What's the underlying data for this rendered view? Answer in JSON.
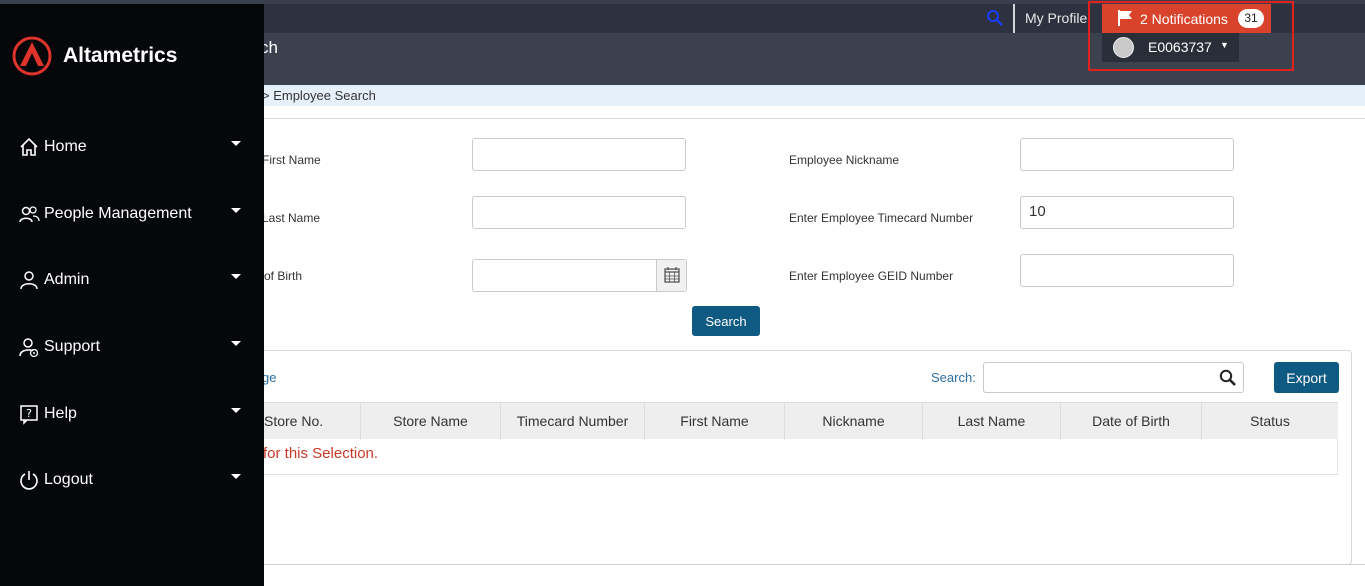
{
  "topbar": {
    "my_profile": "My Profile",
    "notifications_label": "2 Notifications",
    "notifications_badge": "31",
    "user_id": "E0063737"
  },
  "page": {
    "title": "ch",
    "breadcrumb": "> Employee Search"
  },
  "form": {
    "first_name_label": "First Name",
    "last_name_label": "Last Name",
    "dob_label": "of Birth",
    "nickname_label": "Employee Nickname",
    "timecard_label": "Enter Employee Timecard Number",
    "timecard_value": "10",
    "geid_label": "Enter Employee GEID Number",
    "search_button": "Search"
  },
  "results": {
    "page_link": "ge",
    "search_label": "Search:",
    "export_button": "Export",
    "columns": [
      "Store No.",
      "Store Name",
      "Timecard Number",
      "First Name",
      "Nickname",
      "Last Name",
      "Date of Birth",
      "Status"
    ],
    "empty_message": "for this Selection."
  },
  "sidebar": {
    "brand": "Altametrics",
    "items": [
      {
        "label": "Home",
        "icon": "home-icon"
      },
      {
        "label": "People Management",
        "icon": "people-icon"
      },
      {
        "label": "Admin",
        "icon": "user-icon"
      },
      {
        "label": "Support",
        "icon": "support-icon"
      },
      {
        "label": "Help",
        "icon": "help-icon"
      },
      {
        "label": "Logout",
        "icon": "power-icon"
      }
    ]
  },
  "colors": {
    "accent": "#0e5a83",
    "notification": "#d9432c",
    "sidebar": "#06070b",
    "highlight_box": "#e2201c"
  }
}
